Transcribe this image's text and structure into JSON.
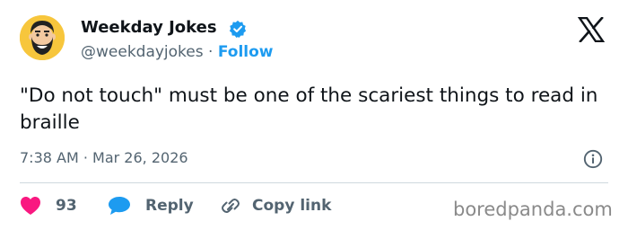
{
  "author": {
    "display_name": "Weekday Jokes",
    "handle": "@weekdayjokes",
    "separator": " · ",
    "follow_label": "Follow",
    "verified": true
  },
  "tweet": {
    "text": "\"Do not touch\" must be one of the scariest things to read in braille",
    "time": "7:38 AM",
    "date_separator": " · ",
    "date": "Mar 26, 2026"
  },
  "actions": {
    "likes_count": "93",
    "reply_label": "Reply",
    "copy_link_label": "Copy link"
  },
  "watermark": "boredpanda.com",
  "colors": {
    "accent": "#1d9bf0",
    "like": "#f91880",
    "text_primary": "#0f1419",
    "text_secondary": "#536471",
    "avatar_bg": "#f7c63c"
  },
  "icons": {
    "avatar": "bearded-man-avatar",
    "verified": "verified-badge-icon",
    "platform": "x-logo-icon",
    "info": "info-icon",
    "like": "heart-icon",
    "reply": "speech-bubble-icon",
    "copy_link": "link-icon"
  }
}
